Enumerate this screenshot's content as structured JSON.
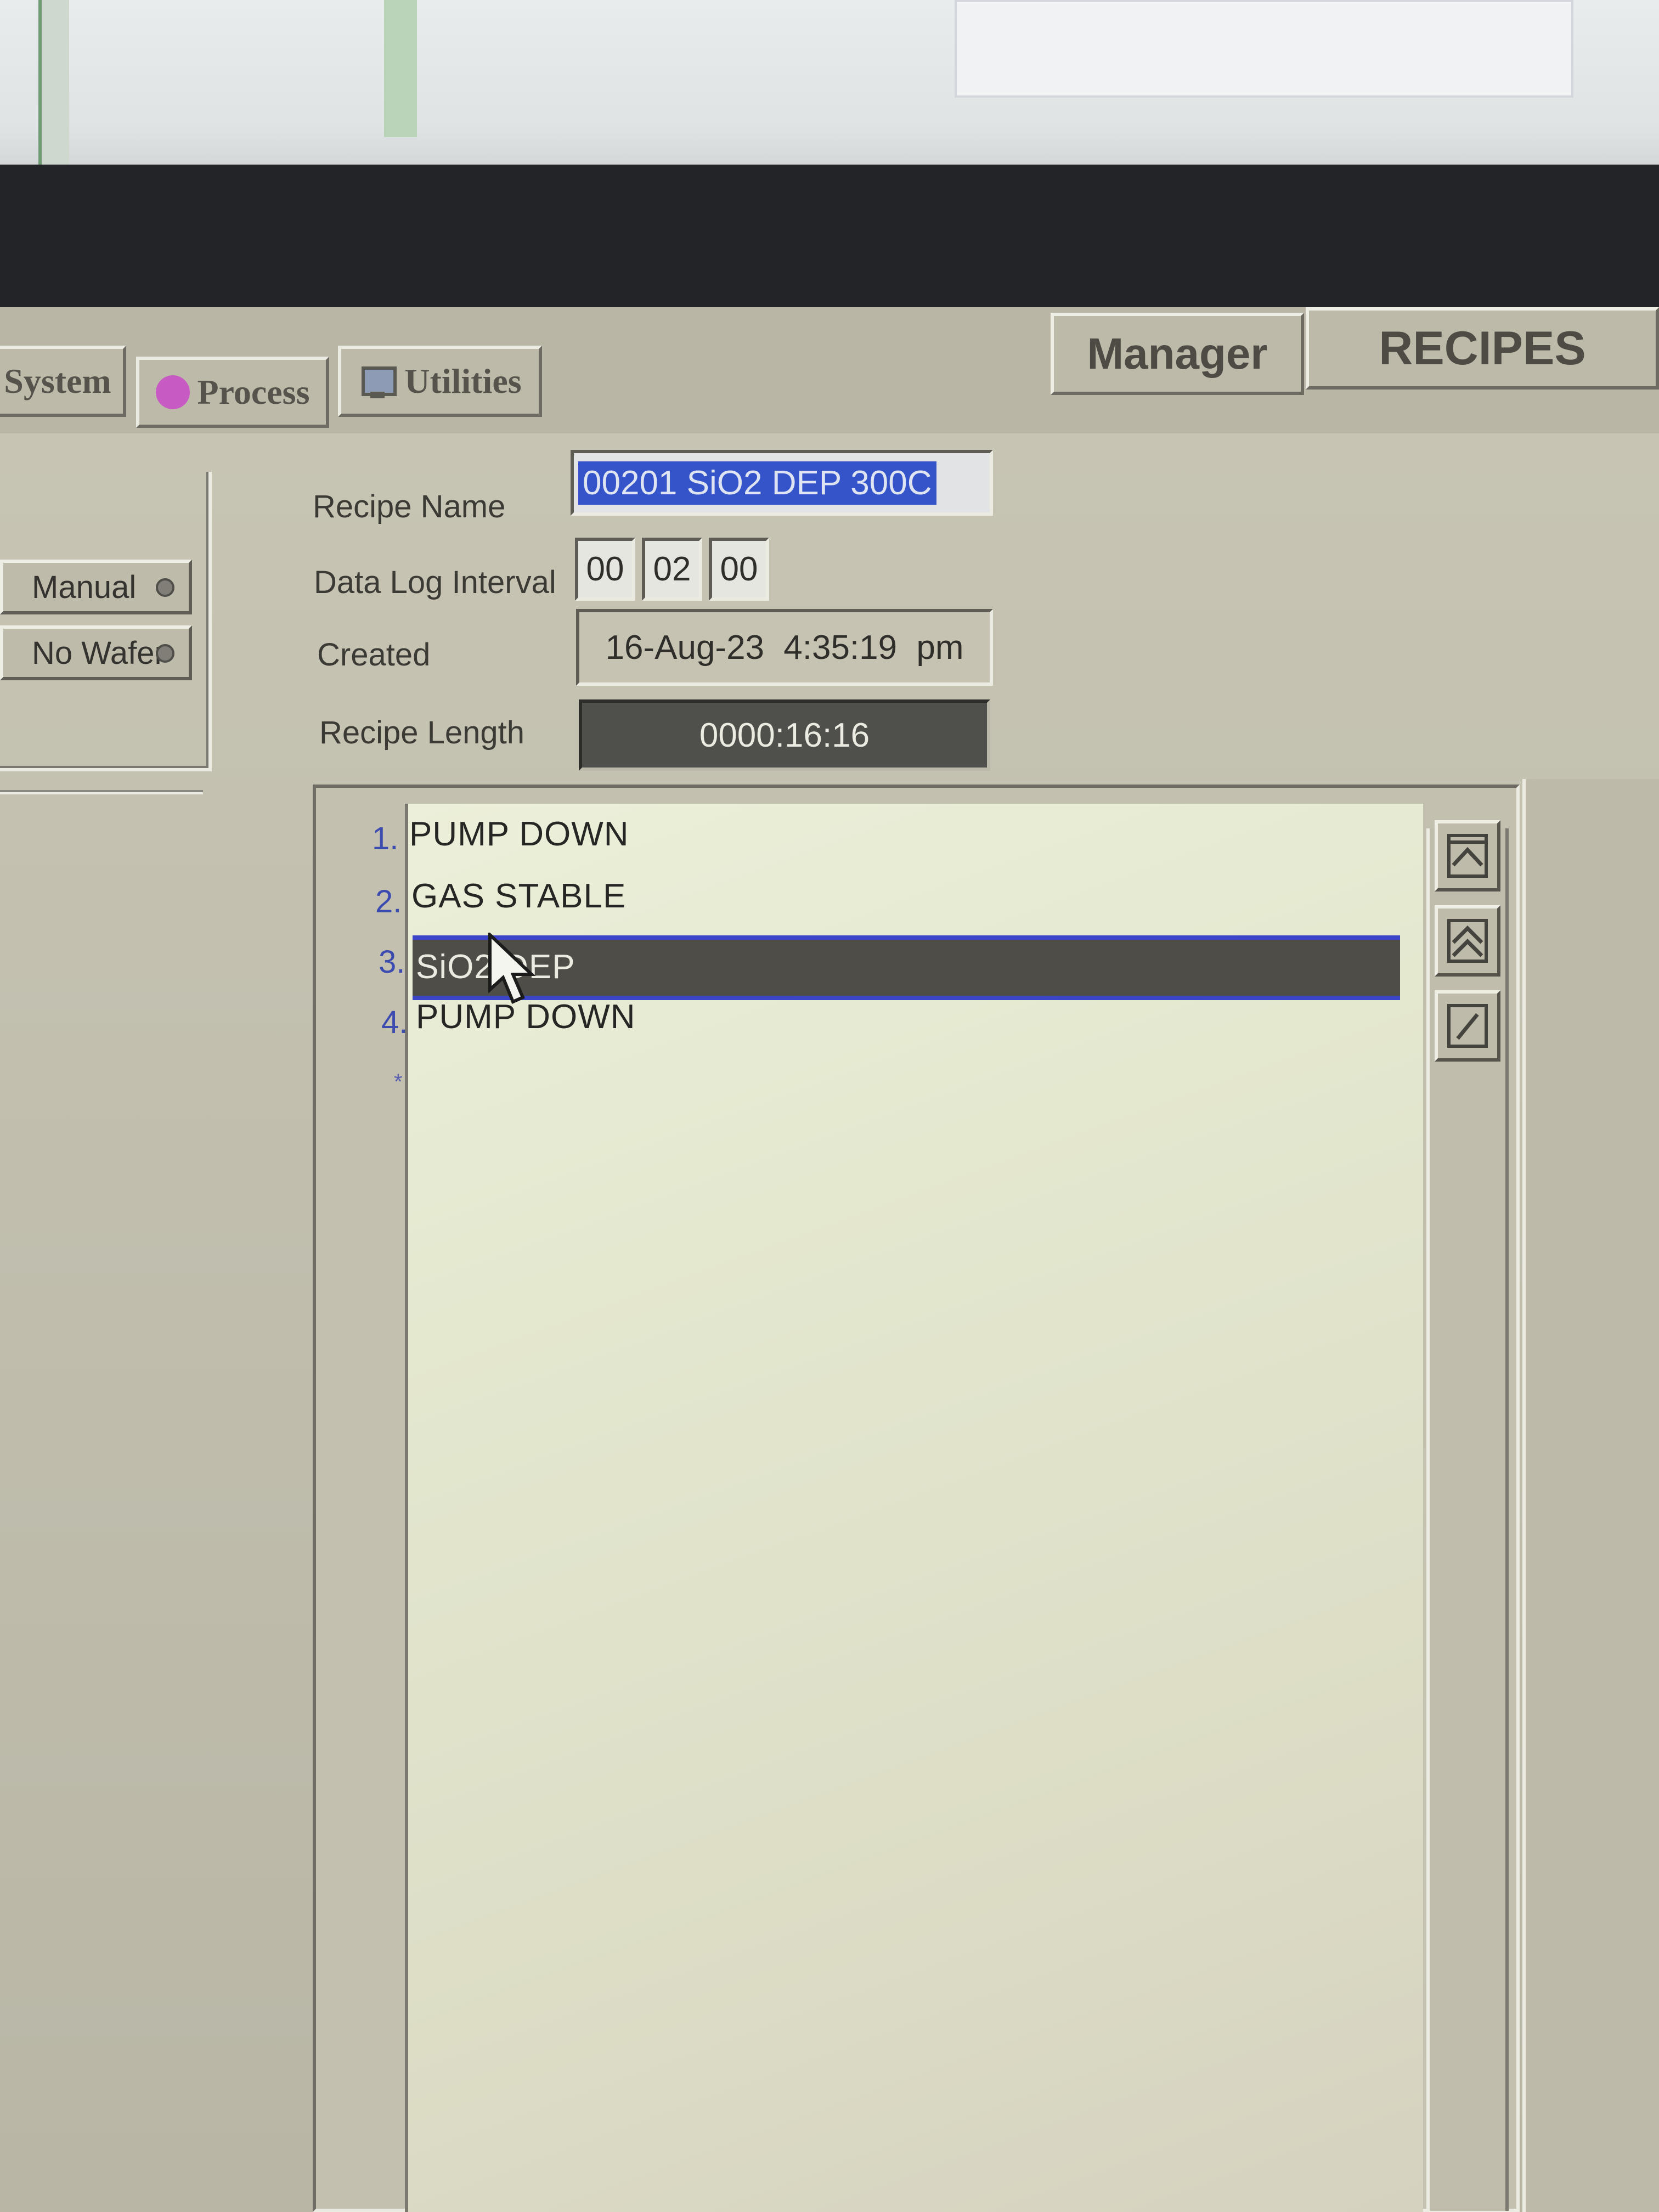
{
  "tabs": {
    "system_label": "System",
    "process_label": "Process",
    "utilities_label": "Utilities",
    "process_icon_color": "#c85bc3"
  },
  "header": {
    "manager_label": "Manager",
    "section_title": "RECIPES"
  },
  "left_panel": {
    "manual_label": "Manual",
    "no_wafer_label": "No Wafer"
  },
  "form": {
    "recipe_name_label": "Recipe Name",
    "recipe_name_value": "00201 SiO2 DEP 300C",
    "data_log_interval_label": "Data Log Interval",
    "data_log_interval": [
      "00",
      "02",
      "00"
    ],
    "created_label": "Created",
    "created_value": "16-Aug-23   4:35:19 pm",
    "recipe_length_label": "Recipe Length",
    "recipe_length_value": "0000:16:16"
  },
  "steps": [
    {
      "number": "1.",
      "label": "PUMP DOWN"
    },
    {
      "number": "2.",
      "label": "GAS STABLE"
    },
    {
      "number": "3.",
      "label": "SiO2 DEP"
    },
    {
      "number": "4.",
      "label": "PUMP DOWN"
    }
  ],
  "selected_step": "SiO2 DEP",
  "end_marker": "*",
  "side_buttons": {
    "top_icon": "move-to-top-icon",
    "up_icon": "move-up-icon",
    "edit_icon": "edit-icon"
  },
  "colors": {
    "selection_border": "#3c45c8",
    "selection_fill": "#4e4d48",
    "highlight_text": "#3554c9"
  }
}
